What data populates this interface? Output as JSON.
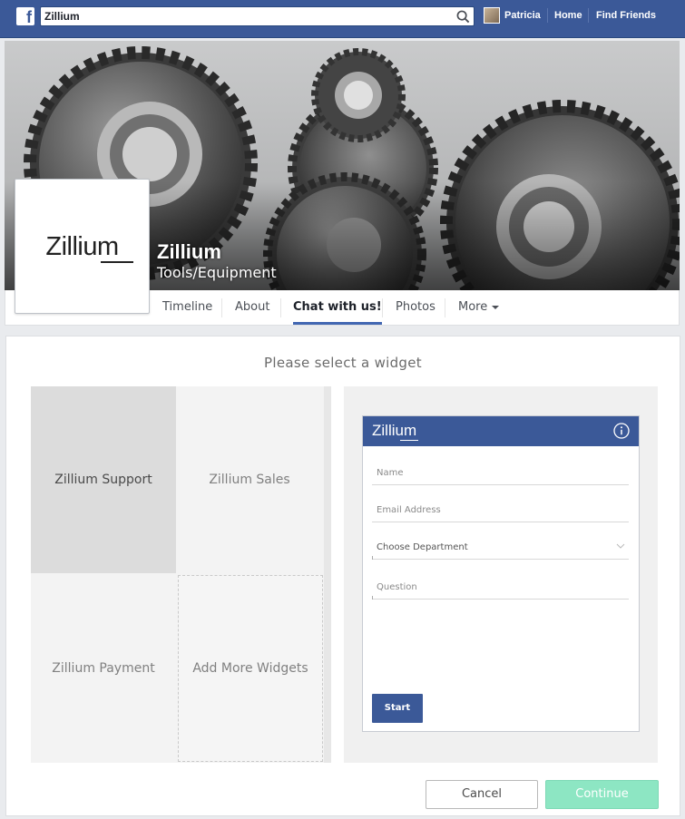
{
  "topbar": {
    "search_value": "Zillium",
    "user_name": "Patricia",
    "home_label": "Home",
    "find_friends_label": "Find Friends"
  },
  "page": {
    "name": "Zillium",
    "category": "Tools/Equipment",
    "logo_text": "Zillium"
  },
  "tabs": [
    {
      "label": "Timeline",
      "active": false
    },
    {
      "label": "About",
      "active": false
    },
    {
      "label": "Chat with us!",
      "active": true
    },
    {
      "label": "Photos",
      "active": false
    },
    {
      "label": "More",
      "active": false
    }
  ],
  "panel": {
    "title": "Please select a widget",
    "tiles": [
      {
        "label": "Zillium Support",
        "selected": true
      },
      {
        "label": "Zillium Sales",
        "selected": false
      },
      {
        "label": "Zillium Payment",
        "selected": false
      },
      {
        "label": "Add More Widgets",
        "selected": false
      }
    ],
    "widget": {
      "logo_text": "Zillium",
      "fields": {
        "name": "Name",
        "email": "Email Address",
        "department": "Choose Department",
        "question": "Question"
      },
      "start_label": "Start"
    },
    "cancel_label": "Cancel",
    "continue_label": "Continue"
  },
  "colors": {
    "facebook_blue": "#3b5998",
    "continue_green": "#8de6c3",
    "selected_tile": "#dcdcdc"
  },
  "icons": [
    "facebook-logo-icon",
    "search-icon",
    "caret-down-icon",
    "info-icon",
    "chevron-down-icon"
  ]
}
